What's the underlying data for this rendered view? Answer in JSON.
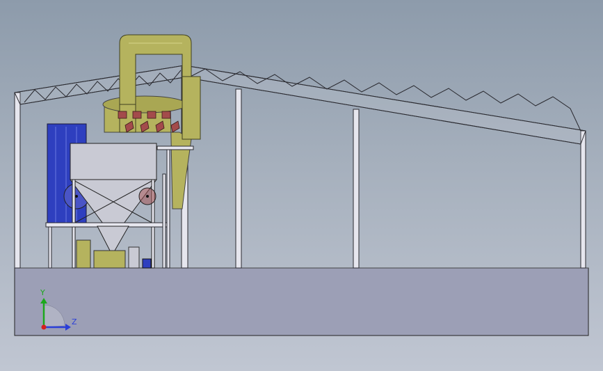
{
  "viewport": {
    "background_top": "#8d9bab",
    "background_bottom": "#c0c6d2"
  },
  "colors": {
    "slab": "#9c9fb6",
    "frame": "#e6e6ee",
    "frame_edge": "#2a2a30",
    "duct": "#b5b35e",
    "hopper": "#c9cad4",
    "blue_panel": "#2e3fbf",
    "fan_red": "#a34b4b"
  },
  "triad": {
    "y_label": "Y",
    "z_label": "Z",
    "y_color": "#1ca81c",
    "z_color": "#2b3fd8",
    "x_color": "#d42020"
  }
}
